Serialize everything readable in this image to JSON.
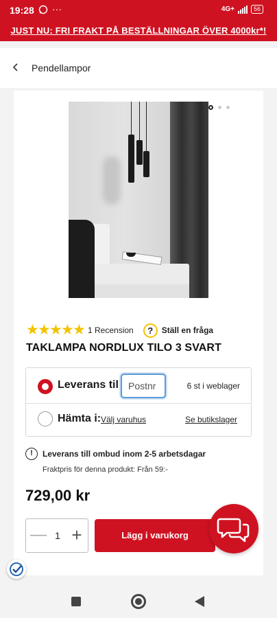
{
  "status_bar": {
    "time": "19:28",
    "network": "4G+",
    "battery": "56"
  },
  "promo": {
    "text": "JUST NU: FRI FRAKT PÅ BESTÄLLNINGAR ÖVER 4000kr*!"
  },
  "breadcrumb": {
    "label": "Pendellampor"
  },
  "product": {
    "rating_stars": 5,
    "review_count_label": "1 Recension",
    "ask_icon_glyph": "?",
    "ask_label": "Ställ en fråga",
    "title": "TAKLAMPA NORDLUX TILO 3 SVART",
    "price": "729,00 kr"
  },
  "delivery": {
    "deliver_label": "Leverans till:",
    "postnr_placeholder": "Postnr",
    "stock_text": "6 st i weblager",
    "pickup_label": "Hämta i:",
    "choose_store_link": "Välj varuhus",
    "see_stock_link": "Se butikslager"
  },
  "shipping_info": {
    "icon_glyph": "!",
    "title": "Leverans till ombud inom 2-5 arbetsdagar",
    "subtitle": "Fraktpris för denna produkt: Från 59:-"
  },
  "cart": {
    "quantity": "1",
    "minus_glyph": "—",
    "plus_glyph": "+",
    "add_to_cart_label": "Lägg i varukorg"
  },
  "colors": {
    "brand_red": "#cf1221",
    "star_yellow": "#f2c300",
    "input_focus": "#5b9ad8"
  }
}
